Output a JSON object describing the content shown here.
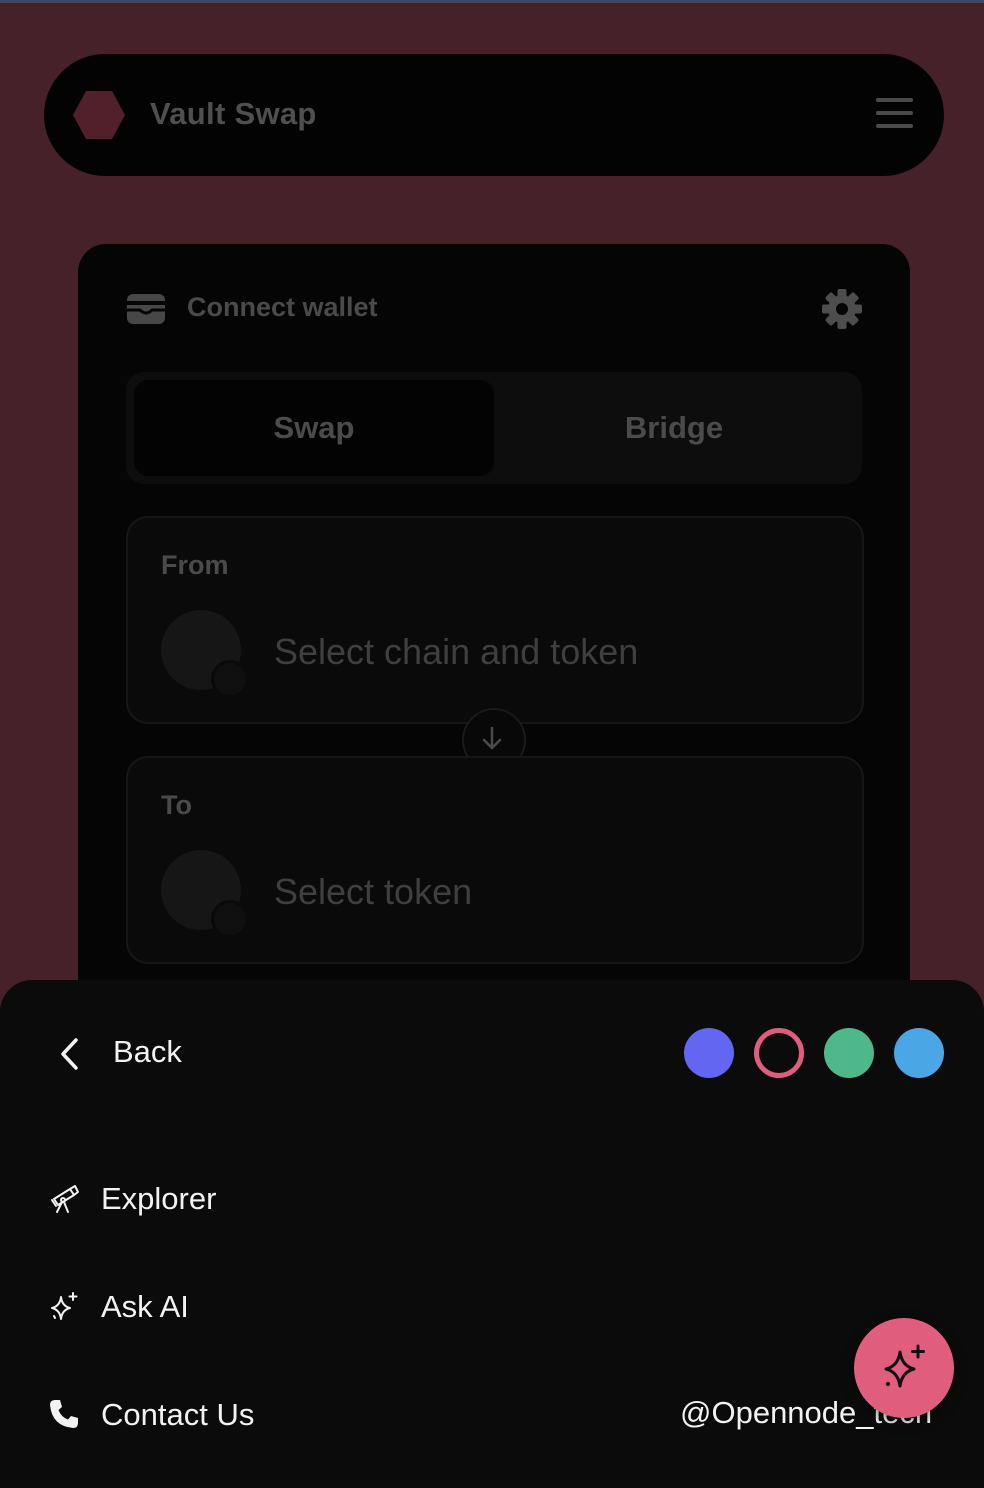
{
  "header": {
    "app_title": "Vault Swap",
    "logo_icon": "hexagon-logo-icon",
    "menu_icon": "hamburger-menu-icon"
  },
  "card": {
    "connect_wallet_label": "Connect wallet",
    "wallet_icon": "wallet-icon",
    "settings_icon": "gear-icon",
    "tabs": [
      {
        "label": "Swap",
        "selected": true
      },
      {
        "label": "Bridge",
        "selected": false
      }
    ],
    "from": {
      "label": "From",
      "placeholder": "Select chain and token"
    },
    "to": {
      "label": "To",
      "placeholder": "Select token"
    },
    "swap_direction_icon": "arrow-down-icon"
  },
  "sheet": {
    "back_label": "Back",
    "theme_swatches": [
      {
        "color": "#6366f1",
        "selected": false
      },
      {
        "color": "#e05d7d",
        "selected": true
      },
      {
        "color": "#4fb88a",
        "selected": false
      },
      {
        "color": "#4ba6e6",
        "selected": false
      }
    ],
    "menu_items": [
      {
        "label": "Explorer",
        "icon": "telescope-icon"
      },
      {
        "label": "Ask AI",
        "icon": "sparkles-icon"
      },
      {
        "label": "Contact Us",
        "icon": "phone-icon"
      }
    ],
    "social_handle": "@Opennode_tech"
  },
  "fab": {
    "icon": "sparkles-icon",
    "color": "#e05d7d"
  }
}
